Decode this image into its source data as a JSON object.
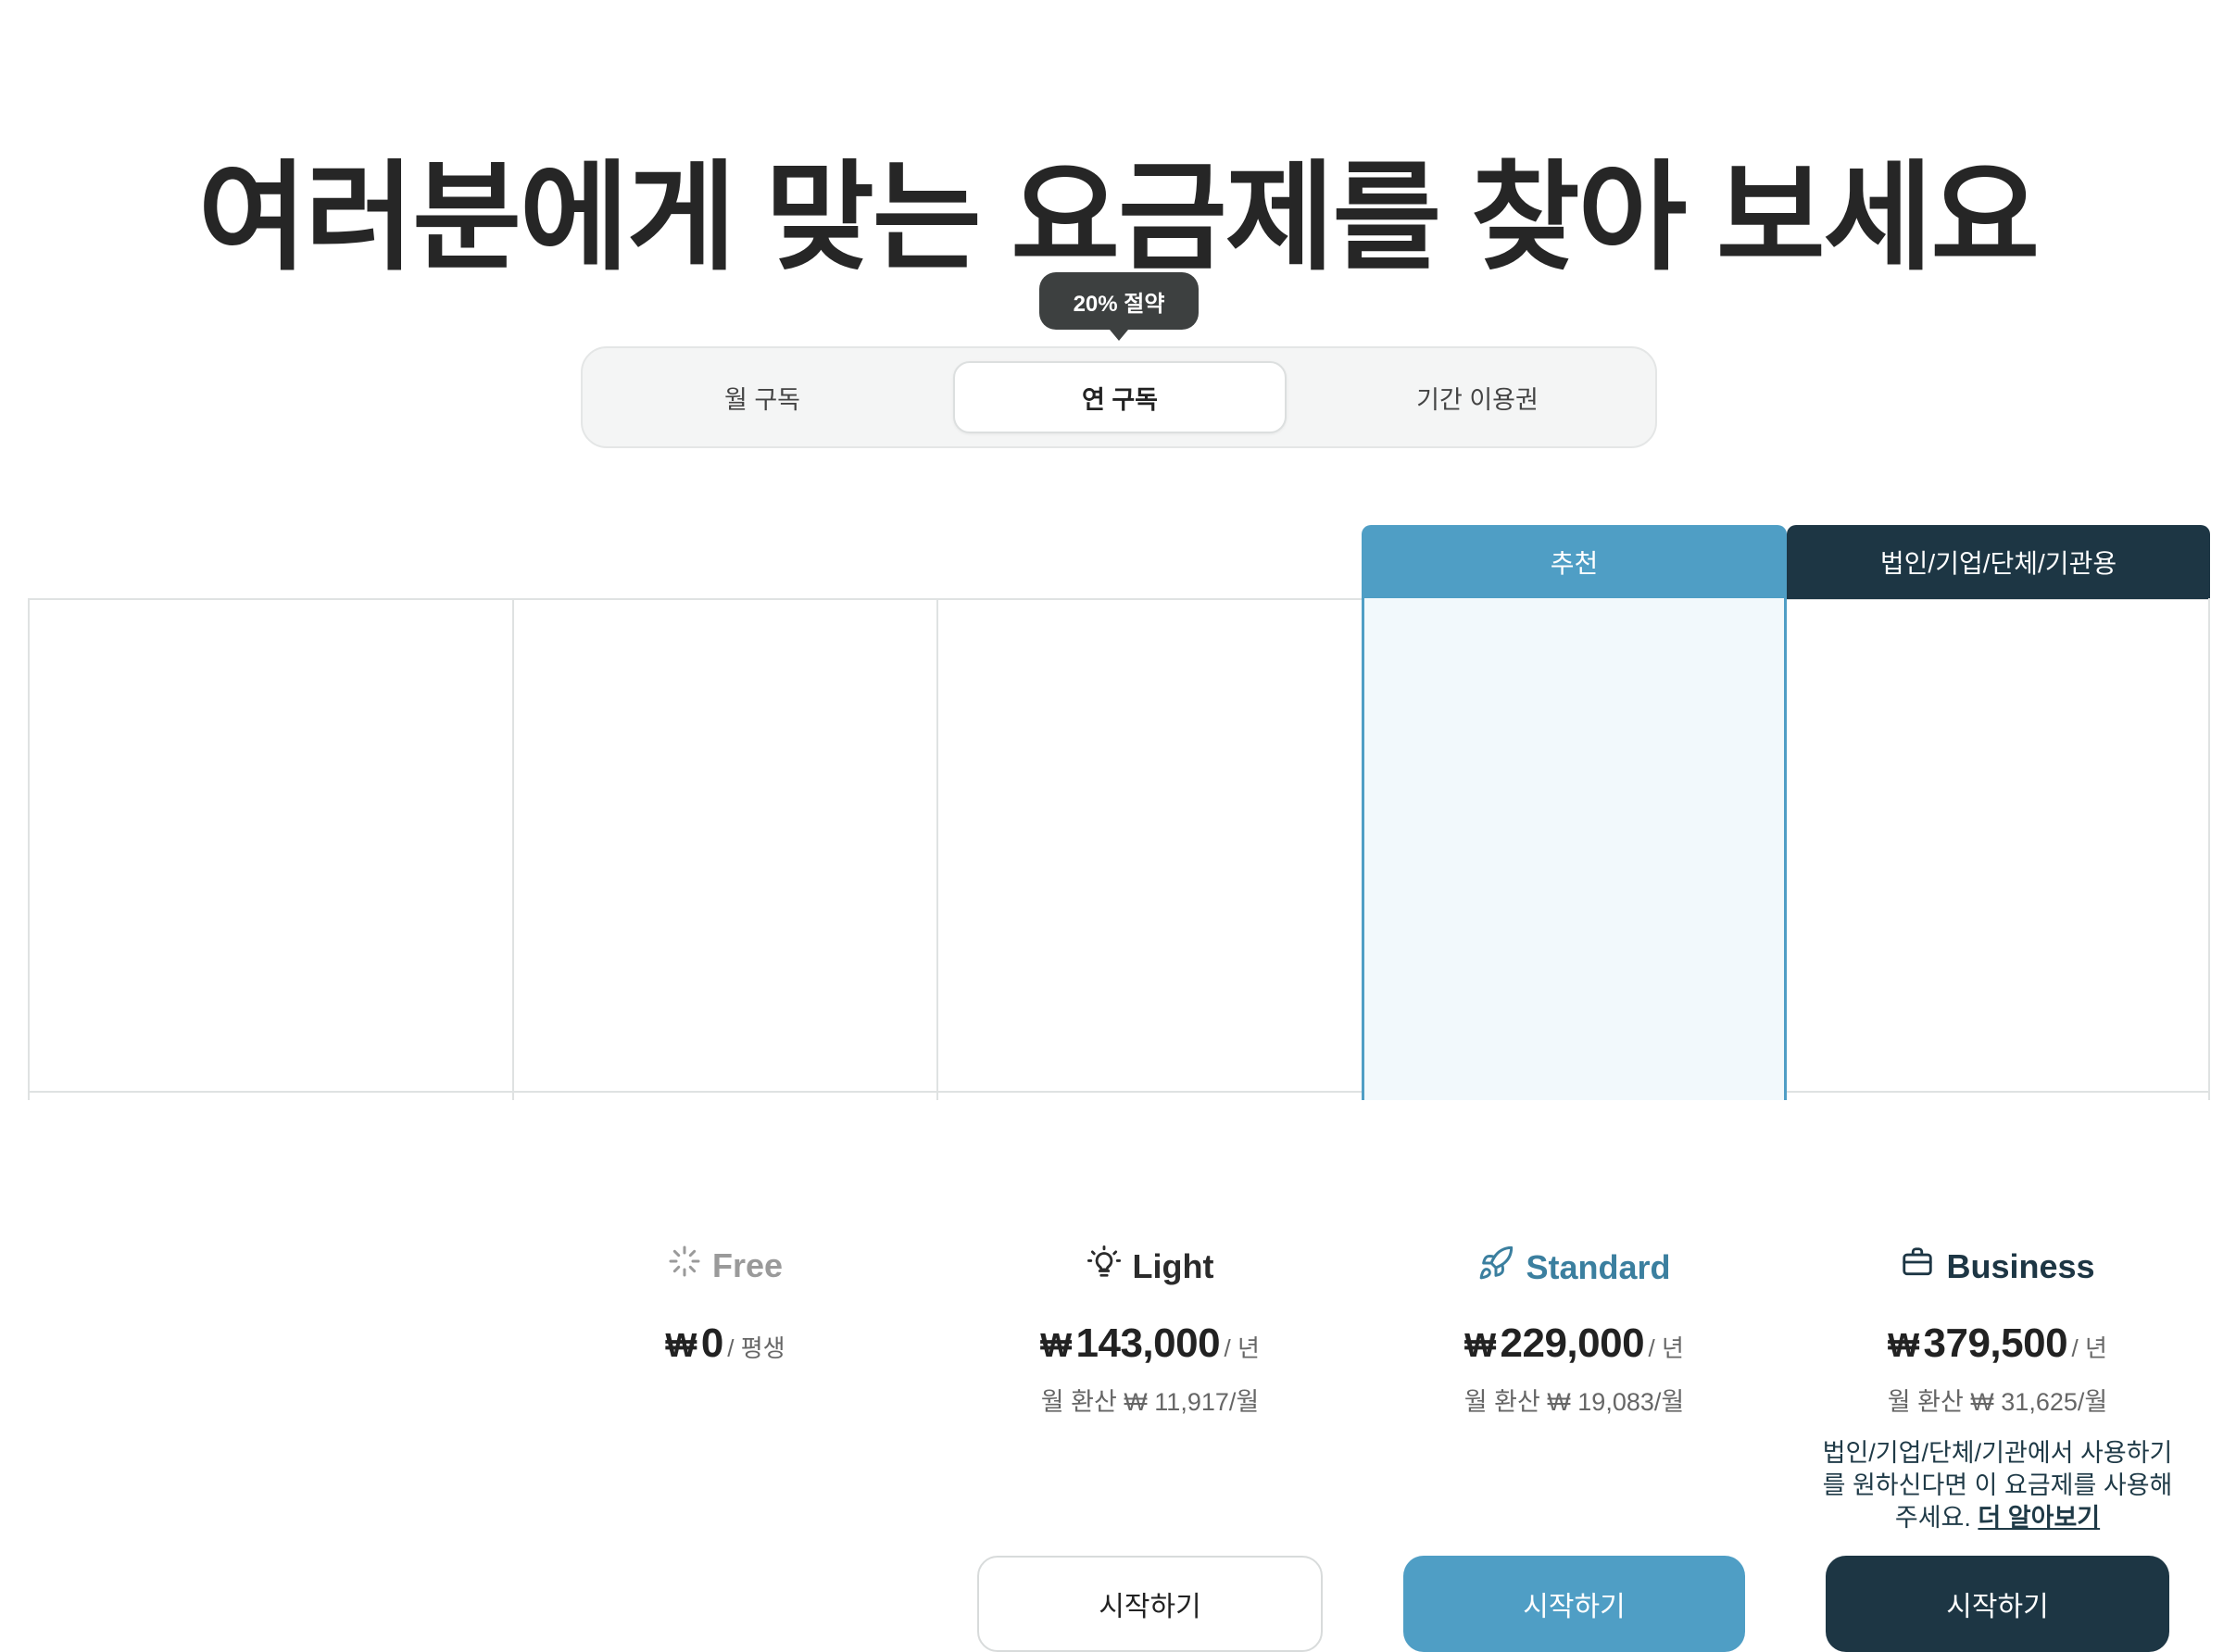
{
  "headline": "여러분에게 맞는 요금제를 찾아 보세요",
  "toggle": {
    "badge": "20% 절약",
    "options": [
      "월 구독",
      "연 구독",
      "기간 이용권"
    ],
    "selected": "연 구독"
  },
  "tabs": {
    "recommended": "추천",
    "business": "법인/기업/단체/기관용"
  },
  "plans": [
    {
      "name": "Free",
      "icon": "loader-icon",
      "color": "#9a9a9a",
      "currency": "₩",
      "price": "0",
      "period": "/ 평생",
      "monthly": "",
      "cta": ""
    },
    {
      "name": "Light",
      "icon": "lightbulb-icon",
      "color": "#2b2b2b",
      "currency": "₩",
      "price": "143,000",
      "period": "/ 년",
      "monthly": "월 환산 ₩ 11,917/월",
      "cta": "시작하기"
    },
    {
      "name": "Standard",
      "icon": "rocket-icon",
      "color": "#3b7f9f",
      "currency": "₩",
      "price": "229,000",
      "period": "/ 년",
      "monthly": "월 환산 ₩ 19,083/월",
      "cta": "시작하기"
    },
    {
      "name": "Business",
      "icon": "briefcase-icon",
      "color": "#1d3644",
      "currency": "₩",
      "price": "379,500",
      "period": "/ 년",
      "monthly": "월 환산 ₩ 31,625/월",
      "description": "법인/기업/단체/기관에서 사용하기를 원하신다면 이 요금제를 사용해 주세요.",
      "learn_more": "더 알아보기",
      "cta": "시작하기"
    }
  ],
  "colors": {
    "accent": "#4f9ec5",
    "business": "#1d3644",
    "recommended_bg": "#f2f9fc"
  }
}
